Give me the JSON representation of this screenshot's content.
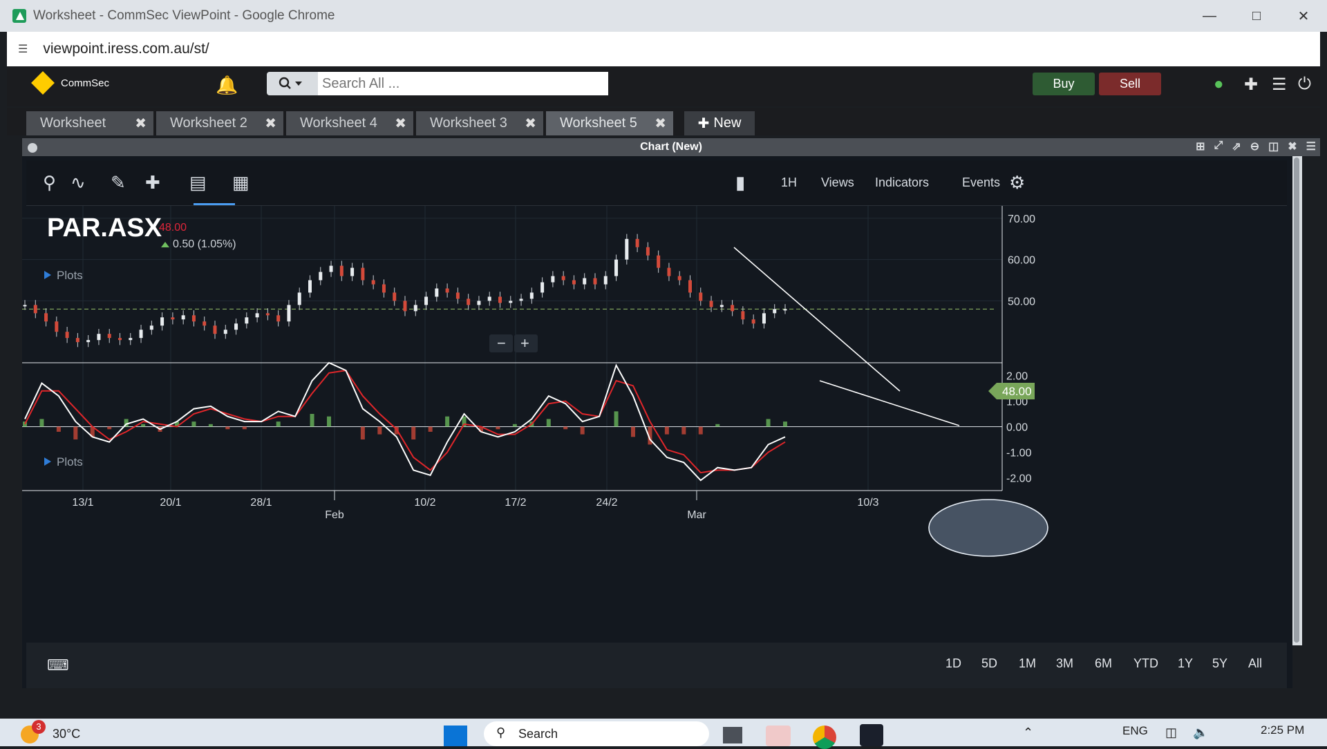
{
  "window": {
    "title": "Worksheet - CommSec ViewPoint - Google Chrome",
    "url": "viewpoint.iress.com.au/st/"
  },
  "header": {
    "brand": "CommSec",
    "search_placeholder": "Search All ...",
    "buy_label": "Buy",
    "sell_label": "Sell"
  },
  "tabs": [
    {
      "label": "Worksheet"
    },
    {
      "label": "Worksheet 2"
    },
    {
      "label": "Worksheet 4"
    },
    {
      "label": "Worksheet 3"
    },
    {
      "label": "Worksheet 5",
      "active": true
    }
  ],
  "new_tab_label": "New",
  "panel": {
    "title": "Chart (New)"
  },
  "toolbar": {
    "timeframe": "1H",
    "views": "Views",
    "indicators": "Indicators",
    "events": "Events"
  },
  "quote": {
    "symbol": "PAR.ASX",
    "price": "48.00",
    "change": "0.50 (1.05%)",
    "plots_label": "Plots",
    "plots_label_2": "Plots",
    "price_tag": "48.00"
  },
  "colors": {
    "up": "#6fbf5f",
    "down": "#d44a3a",
    "macd_line": "#ffffff",
    "signal_line": "#e0262a",
    "price_line": "#7ea15a"
  },
  "chart_data": [
    {
      "type": "line",
      "subtype": "candlestick (approximated by closes)",
      "symbol": "PAR.ASX",
      "y_axis": {
        "ticks": [
          "70.00",
          "60.00",
          "50.00"
        ],
        "ylim": [
          35,
          73
        ]
      },
      "last_price": 48.0,
      "closes": [
        49,
        47,
        45,
        42.5,
        41,
        40,
        40.5,
        42,
        41,
        40.5,
        41,
        43,
        44,
        46,
        45.5,
        46.5,
        45,
        44,
        42,
        43,
        44.5,
        46,
        47,
        46.5,
        45,
        49,
        52,
        55,
        57,
        58.5,
        56,
        58,
        55,
        54,
        52,
        50,
        47.5,
        49,
        51,
        53,
        52,
        50.5,
        49,
        50,
        51,
        49.5,
        50,
        50.5,
        52,
        54.5,
        56,
        55,
        54,
        55.5,
        54,
        56,
        60,
        65,
        63,
        61,
        58,
        56,
        55,
        52,
        50,
        48.5,
        49,
        47.5,
        45.5,
        44.5,
        47,
        48,
        48
      ]
    },
    {
      "type": "line",
      "subtype": "MACD (line, signal, histogram)",
      "y_axis": {
        "ticks": [
          "2.00",
          "1.00",
          "0.00",
          "-1.00",
          "-2.00"
        ],
        "ylim": [
          -2.5,
          2.5
        ]
      },
      "macd": [
        0.3,
        1.7,
        1.2,
        0.2,
        -0.4,
        -0.6,
        0.1,
        0.3,
        -0.1,
        0.2,
        0.7,
        0.8,
        0.4,
        0.2,
        0.2,
        0.6,
        0.4,
        1.8,
        2.5,
        2.2,
        0.7,
        0.2,
        -0.4,
        -1.7,
        -1.9,
        -0.6,
        0.5,
        -0.2,
        -0.4,
        -0.2,
        0.3,
        1.2,
        0.9,
        0.2,
        0.4,
        2.4,
        1.2,
        -0.5,
        -1.2,
        -1.4,
        -2.1,
        -1.6,
        -1.7,
        -1.6,
        -0.7,
        -0.4
      ],
      "signal": [
        0.1,
        1.4,
        1.4,
        0.7,
        0.0,
        -0.5,
        -0.2,
        0.2,
        0.1,
        0.0,
        0.5,
        0.7,
        0.5,
        0.3,
        0.2,
        0.4,
        0.4,
        1.3,
        2.1,
        2.2,
        1.2,
        0.5,
        -0.1,
        -1.2,
        -1.7,
        -1.0,
        0.1,
        0.0,
        -0.3,
        -0.3,
        0.1,
        0.9,
        1.0,
        0.5,
        0.4,
        1.8,
        1.6,
        0.2,
        -0.9,
        -1.1,
        -1.8,
        -1.7,
        -1.7,
        -1.6,
        -1.0,
        -0.6
      ],
      "annotations": [
        "trendline upper",
        "trendline lower",
        "ellipse highlight"
      ]
    }
  ],
  "x_axis": {
    "labels": [
      "13/1",
      "20/1",
      "28/1",
      "10/2",
      "17/2",
      "24/2",
      "10/3"
    ],
    "months": [
      "Feb",
      "Mar"
    ]
  },
  "ranges": [
    "1D",
    "5D",
    "1M",
    "3M",
    "6M",
    "YTD",
    "1Y",
    "5Y",
    "All"
  ],
  "taskbar": {
    "temp": "30°C",
    "weather_badge": "3",
    "search": "Search",
    "lang": "ENG",
    "time": "2:25 PM"
  }
}
